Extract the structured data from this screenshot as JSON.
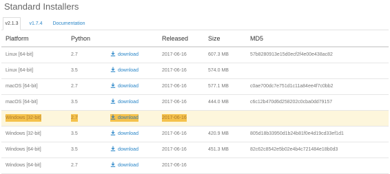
{
  "title": "Standard Installers",
  "tabs": [
    {
      "label": "v2.1.3",
      "active": true
    },
    {
      "label": "v1.7.4",
      "active": false
    },
    {
      "label": "Documentation",
      "active": false
    }
  ],
  "columns": {
    "platform": "Platform",
    "python": "Python",
    "released": "Released",
    "size": "Size",
    "md5": "MD5"
  },
  "download_icon": "download-arrow-icon",
  "colors": {
    "link": "#2a86c8",
    "highlight": "#f5c24c",
    "highlight_row": "#fdf6dc"
  },
  "rows": [
    {
      "platform": "Linux [64-bit]",
      "python": "2.7",
      "link": "download",
      "released": "2017-06-16",
      "size": "607.3 MB",
      "md5": "57b8280913e15d0ecf2f4e00e438ac82",
      "highlighted": false
    },
    {
      "platform": "Linux [64-bit]",
      "python": "3.5",
      "link": "download",
      "released": "2017-06-16",
      "size": "574.0 MB",
      "md5": "",
      "highlighted": false
    },
    {
      "platform": "macOS [64-bit]",
      "python": "2.7",
      "link": "download",
      "released": "2017-06-16",
      "size": "577.1 MB",
      "md5": "c0ae700dc7e751d1c11a84ee4f7c0bb2",
      "highlighted": false
    },
    {
      "platform": "macOS [64-bit]",
      "python": "3.5",
      "link": "download",
      "released": "2017-06-16",
      "size": "444.0 MB",
      "md5": "c6c12b470d6d258202c0cba0dd79157",
      "highlighted": false
    },
    {
      "platform": "Windows [32-bit]",
      "python": "2.7",
      "link": "download",
      "released": "2017-06-16",
      "size": "",
      "md5": "",
      "highlighted": true
    },
    {
      "platform": "Windows [32-bit]",
      "python": "3.5",
      "link": "download",
      "released": "2017-06-16",
      "size": "420.9 MB",
      "md5": "805d18b33950d1b24b81f0e4d19cd33ef1d1",
      "highlighted": false
    },
    {
      "platform": "Windows [64-bit]",
      "python": "3.5",
      "link": "download",
      "released": "2017-06-16",
      "size": "451.3 MB",
      "md5": "82c62c8542e5b02e4b4c721484e18b0d3",
      "highlighted": false
    },
    {
      "platform": "Windows [64-bit]",
      "python": "2.7",
      "link": "download",
      "released": "2017-06-16",
      "size": "",
      "md5": "",
      "highlighted": false
    }
  ]
}
